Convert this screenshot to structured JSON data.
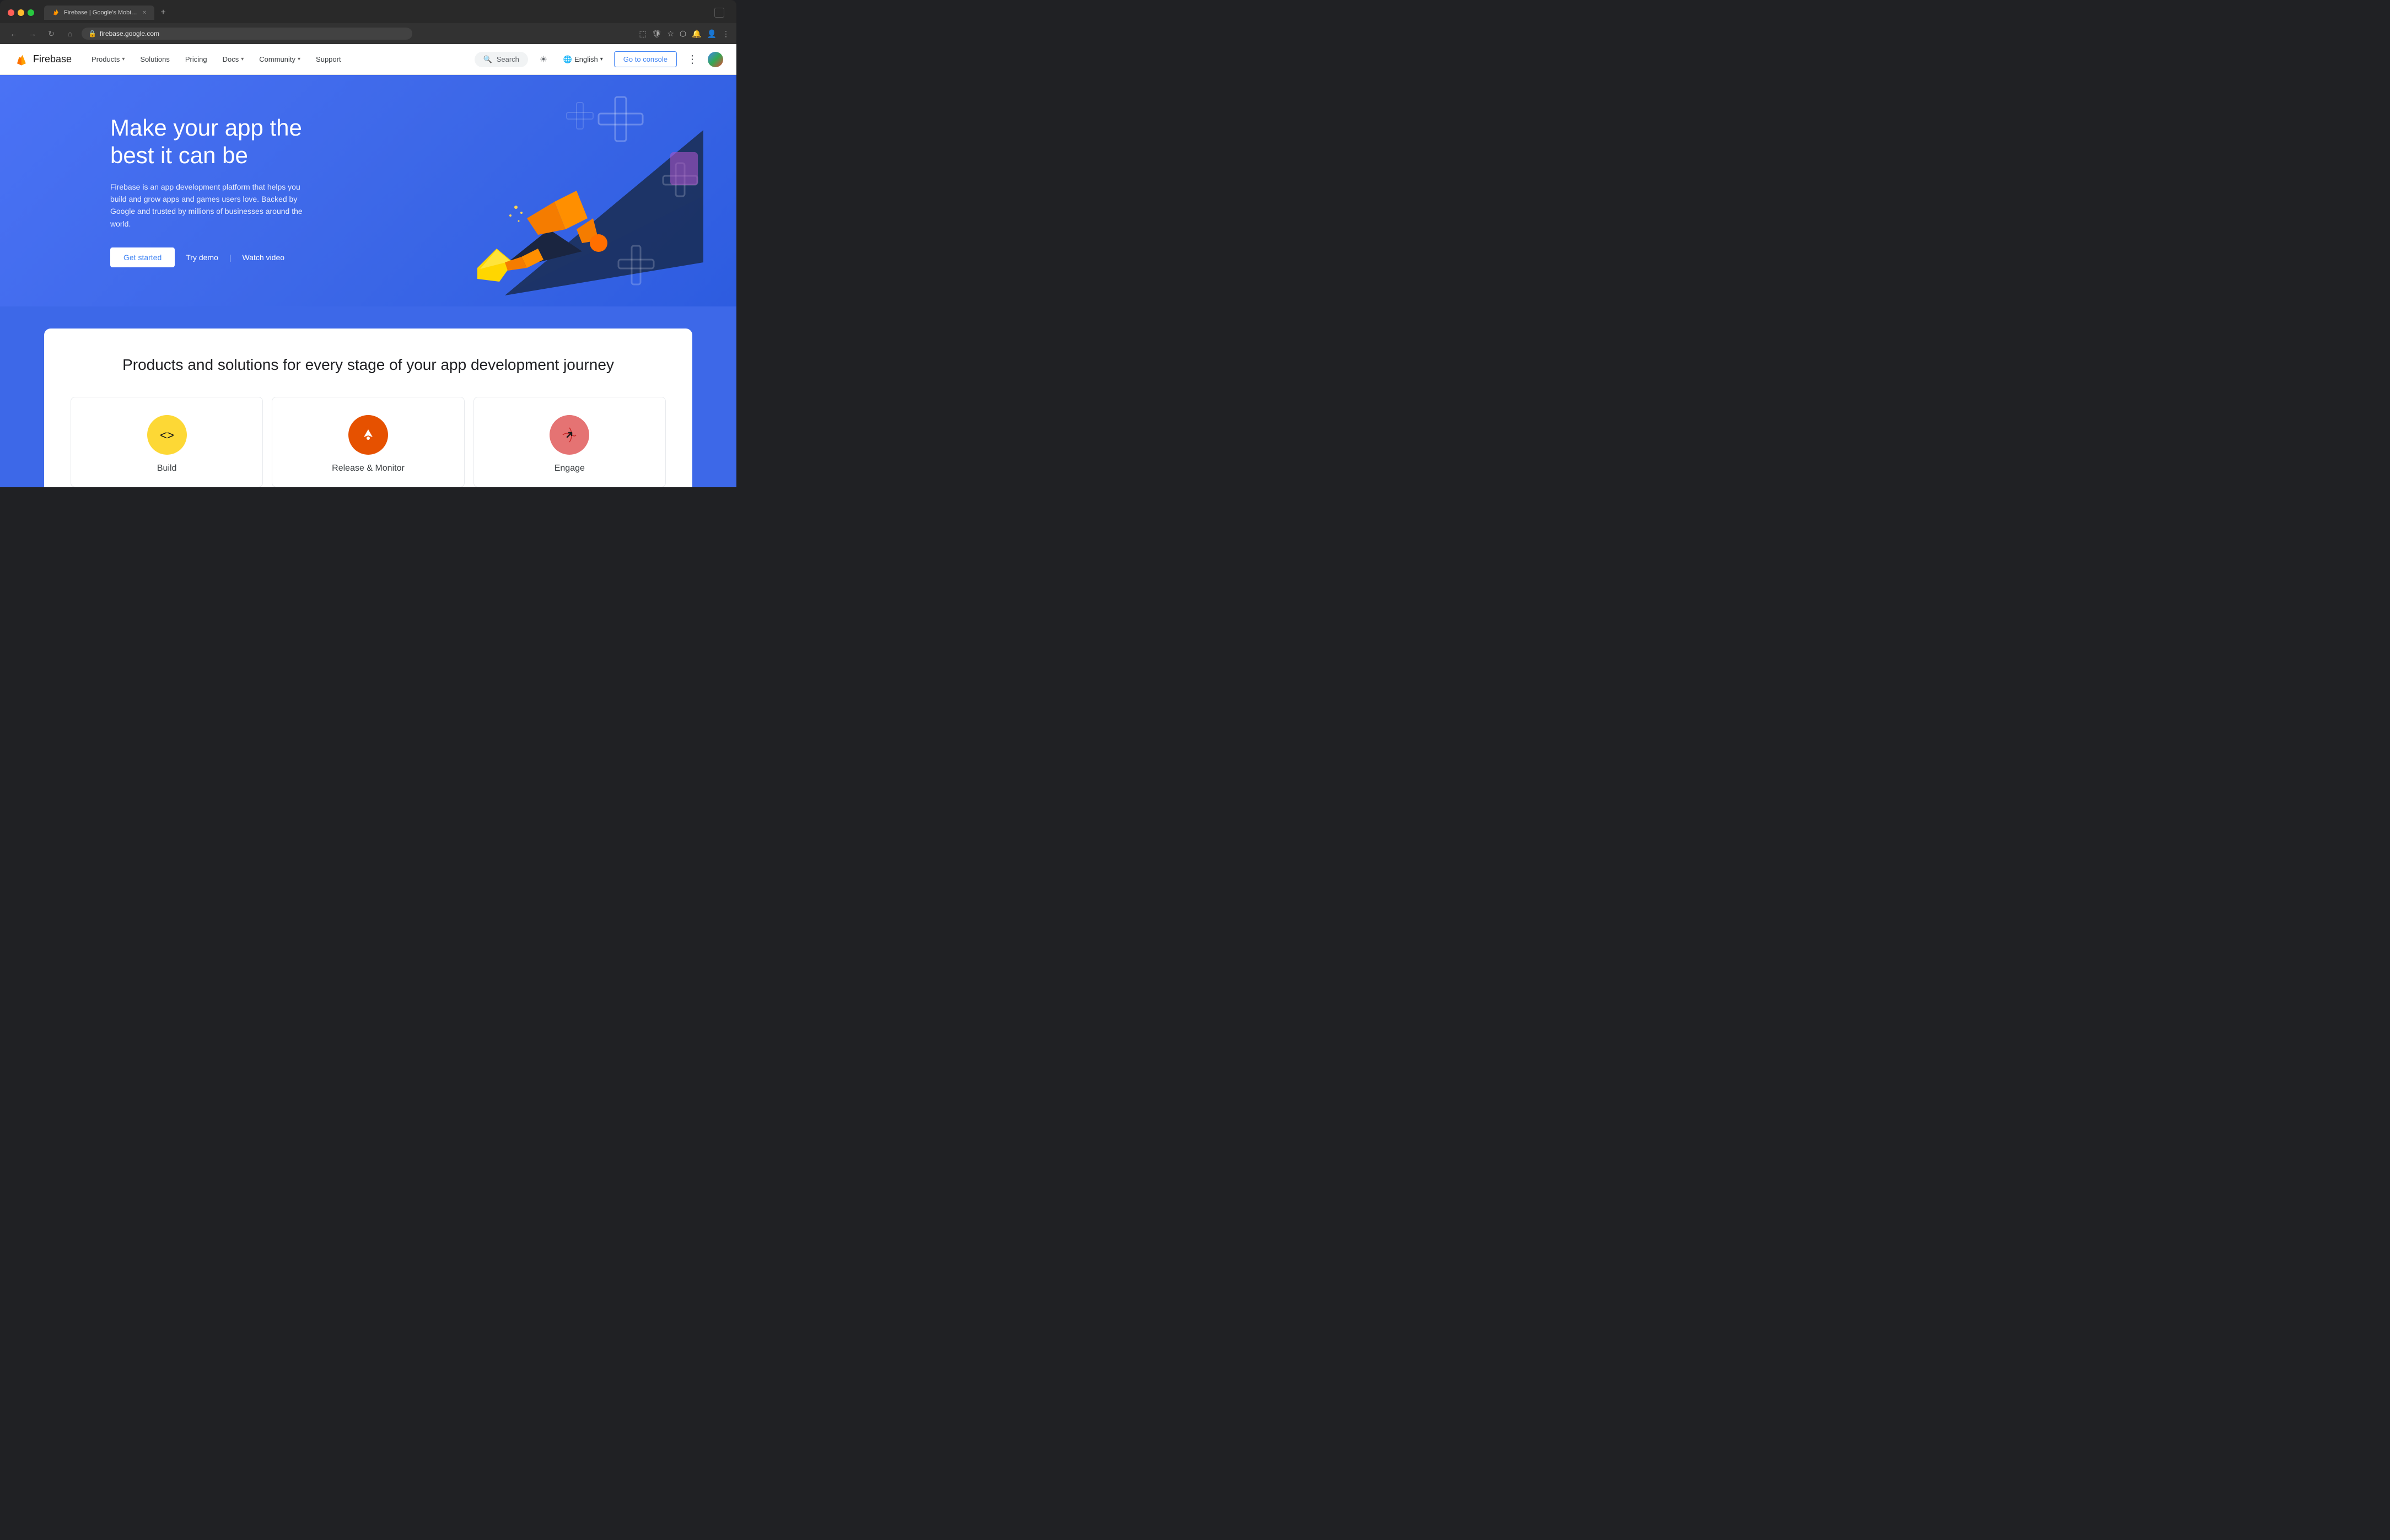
{
  "browser": {
    "tab_title": "Firebase | Google's Mobile a...",
    "url": "firebase.google.com",
    "new_tab_label": "+",
    "nav_buttons": {
      "back": "←",
      "forward": "→",
      "refresh": "↻",
      "home": "⌂"
    }
  },
  "nav": {
    "logo_text": "Firebase",
    "links": [
      {
        "label": "Products",
        "has_dropdown": true
      },
      {
        "label": "Solutions",
        "has_dropdown": false
      },
      {
        "label": "Pricing",
        "has_dropdown": false
      },
      {
        "label": "Docs",
        "has_dropdown": true
      },
      {
        "label": "Community",
        "has_dropdown": true
      },
      {
        "label": "Support",
        "has_dropdown": false
      }
    ],
    "search_placeholder": "Search",
    "language": "English",
    "console_label": "Go to console"
  },
  "hero": {
    "title": "Make your app the best it can be",
    "description": "Firebase is an app development platform that helps you build and grow apps and games users love. Backed by Google and trusted by millions of businesses around the world.",
    "cta_primary": "Get started",
    "cta_secondary": "Try demo",
    "cta_tertiary": "Watch video"
  },
  "products_section": {
    "title": "Products and solutions for every stage of your app development journey",
    "cards": [
      {
        "name": "Build",
        "icon": "◁▷",
        "icon_type": "build"
      },
      {
        "name": "Release & Monitor",
        "icon": "🚀",
        "icon_type": "release"
      },
      {
        "name": "Engage",
        "icon": "📈",
        "icon_type": "engage"
      }
    ]
  },
  "icons": {
    "search": "🔍",
    "globe": "🌐",
    "chevron_down": "▾",
    "sun": "☀",
    "more_vert": "⋮",
    "lock": "🔒"
  }
}
